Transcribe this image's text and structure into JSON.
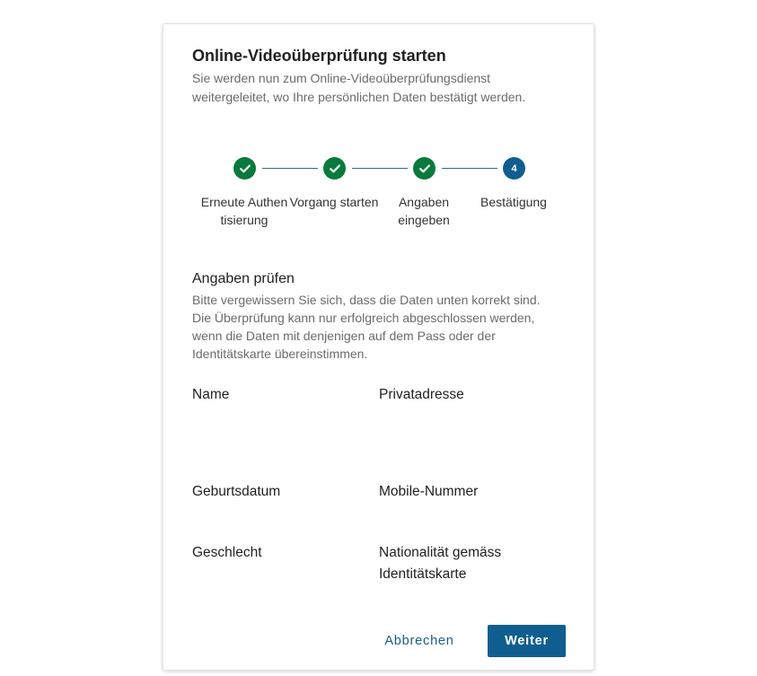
{
  "dialog": {
    "title": "Online-Videoüberprüfung starten",
    "subtitle": "Sie werden nun zum Online-Videoüberprüfungsdienst weitergeleitet, wo Ihre persönlichen Daten bestätigt werden."
  },
  "stepper": {
    "steps": [
      {
        "label": "Erneute Authentisierung",
        "status": "done",
        "icon": "check-icon"
      },
      {
        "label": "Vorgang starten",
        "status": "done",
        "icon": "check-icon"
      },
      {
        "label": "Angaben eingeben",
        "status": "done",
        "icon": "check-icon"
      },
      {
        "label": "Bestätigung",
        "status": "active",
        "number": "4"
      }
    ]
  },
  "review": {
    "title": "Angaben prüfen",
    "text": "Bitte vergewissern Sie sich, dass die Daten unten korrekt sind. Die Überprüfung kann nur erfolgreich abgeschlossen werden, wenn die Daten mit denjenigen auf dem Pass oder der Identitätskarte übereinstimmen."
  },
  "fields": {
    "name": "Name",
    "address": "Privatadresse",
    "birthdate": "Geburtsdatum",
    "mobile": "Mobile-Nummer",
    "gender": "Geschlecht",
    "nationality": "Nationalität gemäss Identitätskarte"
  },
  "actions": {
    "cancel": "Abbrechen",
    "next": "Weiter"
  },
  "colors": {
    "done": "#087a3b",
    "active": "#0f5e8f",
    "line": "#2f6c93",
    "primary_button": "#0f5e8f"
  }
}
